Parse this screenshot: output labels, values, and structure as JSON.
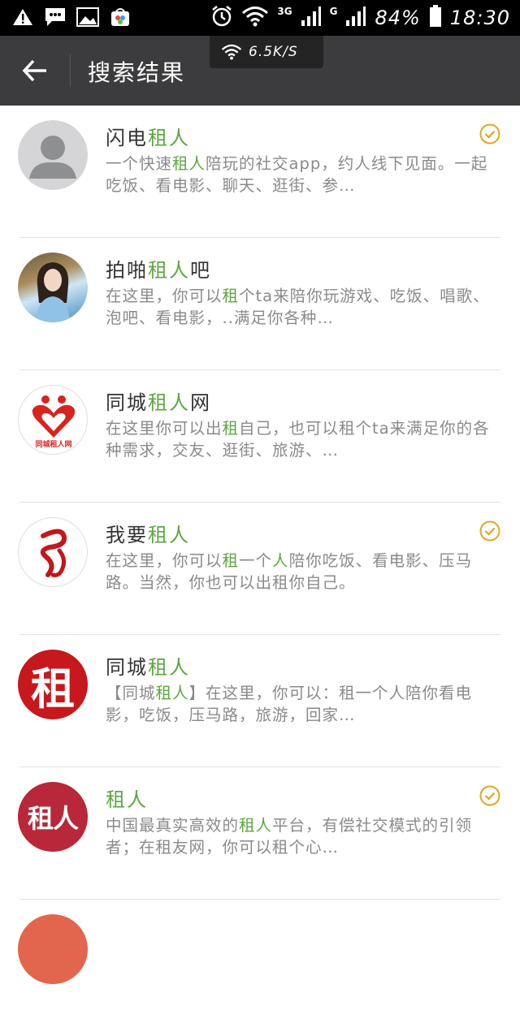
{
  "status_bar": {
    "network_3g": "3G",
    "network_g": "G",
    "battery": "84%",
    "time": "18:30"
  },
  "speed_toast": {
    "text": "6.5K/S"
  },
  "app_bar": {
    "title": "搜索结果"
  },
  "results": [
    {
      "avatar": "default-person-avatar",
      "name_parts": [
        {
          "t": "闪电"
        },
        {
          "t": "租人",
          "hl": true
        }
      ],
      "desc_parts": [
        {
          "t": "一个快速"
        },
        {
          "t": "租人",
          "hl": true
        },
        {
          "t": "陪玩的社交app，约人线下见面。一起吃饭、看电影、聊天、逛街、参…"
        }
      ],
      "verified": true
    },
    {
      "avatar": "girl-photo-avatar",
      "name_parts": [
        {
          "t": "拍啪"
        },
        {
          "t": "租人",
          "hl": true
        },
        {
          "t": "吧"
        }
      ],
      "desc_parts": [
        {
          "t": "在这里，你可以"
        },
        {
          "t": "租",
          "hl": true
        },
        {
          "t": "个ta来陪你玩游戏、吃饭、唱歌、泡吧、看电影，..满足你各种…"
        }
      ],
      "verified": false
    },
    {
      "avatar": "tongcheng-zurenwang-logo",
      "avatar_text": "同城租人网",
      "name_parts": [
        {
          "t": "同城"
        },
        {
          "t": "租人",
          "hl": true
        },
        {
          "t": "网"
        }
      ],
      "desc_parts": [
        {
          "t": "在这里你可以出"
        },
        {
          "t": "租",
          "hl": true
        },
        {
          "t": "自己，也可以租个ta来满足你的各种需求，交友、逛街、旅游、…"
        }
      ],
      "verified": false
    },
    {
      "avatar": "red-brush-logo",
      "name_parts": [
        {
          "t": "我要"
        },
        {
          "t": "租人",
          "hl": true
        }
      ],
      "desc_parts": [
        {
          "t": "在这里，你可以"
        },
        {
          "t": "租",
          "hl": true
        },
        {
          "t": "一个"
        },
        {
          "t": "人",
          "hl": true
        },
        {
          "t": "陪你吃饭、看电影、压马路。当然，你也可以出租你自己。"
        }
      ],
      "verified": true
    },
    {
      "avatar": "zu-character-logo",
      "avatar_text": "租",
      "name_parts": [
        {
          "t": "同城"
        },
        {
          "t": "租人",
          "hl": true
        }
      ],
      "desc_parts": [
        {
          "t": "【同城"
        },
        {
          "t": "租人",
          "hl": true
        },
        {
          "t": "】在这里，你可以：租一个人陪你看电影，吃饭，压马路，旅游，回家…"
        }
      ],
      "verified": false
    },
    {
      "avatar": "zuren-text-logo",
      "avatar_text": "租人",
      "name_parts": [
        {
          "t": "租人",
          "hl": true
        }
      ],
      "desc_parts": [
        {
          "t": "中国最真实高效的"
        },
        {
          "t": "租人",
          "hl": true
        },
        {
          "t": "平台，有偿社交模式的引领者；在租友网，你可以租个心…"
        }
      ],
      "verified": true
    }
  ],
  "colors": {
    "highlight": "#5fa542",
    "appbar": "#3c3c3e",
    "verified": "#e3a528"
  }
}
